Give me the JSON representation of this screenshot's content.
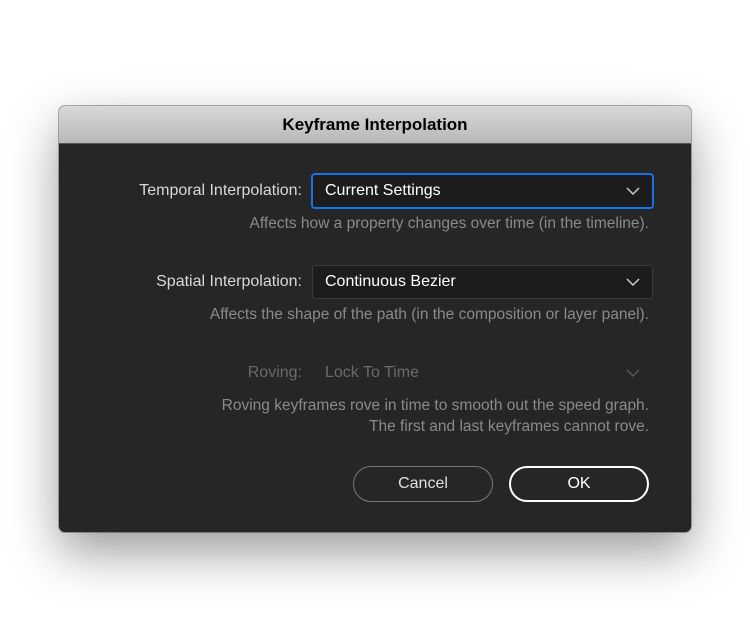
{
  "dialog": {
    "title": "Keyframe Interpolation",
    "temporal": {
      "label": "Temporal Interpolation:",
      "value": "Current Settings",
      "help": "Affects how a property changes over time (in the timeline)."
    },
    "spatial": {
      "label": "Spatial Interpolation:",
      "value": "Continuous Bezier",
      "help": "Affects the shape of the path (in the composition or layer panel)."
    },
    "roving": {
      "label": "Roving:",
      "value": "Lock To Time",
      "help_line1": "Roving keyframes rove in time to smooth out the speed graph.",
      "help_line2": "The first and last keyframes cannot rove."
    },
    "buttons": {
      "cancel": "Cancel",
      "ok": "OK"
    }
  }
}
